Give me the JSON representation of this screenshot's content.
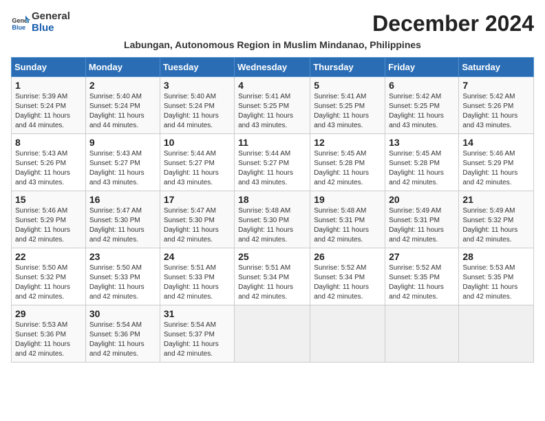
{
  "logo": {
    "general": "General",
    "blue": "Blue"
  },
  "header": {
    "month_title": "December 2024",
    "location": "Labungan, Autonomous Region in Muslim Mindanao, Philippines"
  },
  "weekdays": [
    "Sunday",
    "Monday",
    "Tuesday",
    "Wednesday",
    "Thursday",
    "Friday",
    "Saturday"
  ],
  "weeks": [
    [
      {
        "day": "1",
        "sunrise": "5:39 AM",
        "sunset": "5:24 PM",
        "daylight": "11 hours and 44 minutes."
      },
      {
        "day": "2",
        "sunrise": "5:40 AM",
        "sunset": "5:24 PM",
        "daylight": "11 hours and 44 minutes."
      },
      {
        "day": "3",
        "sunrise": "5:40 AM",
        "sunset": "5:24 PM",
        "daylight": "11 hours and 44 minutes."
      },
      {
        "day": "4",
        "sunrise": "5:41 AM",
        "sunset": "5:25 PM",
        "daylight": "11 hours and 43 minutes."
      },
      {
        "day": "5",
        "sunrise": "5:41 AM",
        "sunset": "5:25 PM",
        "daylight": "11 hours and 43 minutes."
      },
      {
        "day": "6",
        "sunrise": "5:42 AM",
        "sunset": "5:25 PM",
        "daylight": "11 hours and 43 minutes."
      },
      {
        "day": "7",
        "sunrise": "5:42 AM",
        "sunset": "5:26 PM",
        "daylight": "11 hours and 43 minutes."
      }
    ],
    [
      {
        "day": "8",
        "sunrise": "5:43 AM",
        "sunset": "5:26 PM",
        "daylight": "11 hours and 43 minutes."
      },
      {
        "day": "9",
        "sunrise": "5:43 AM",
        "sunset": "5:27 PM",
        "daylight": "11 hours and 43 minutes."
      },
      {
        "day": "10",
        "sunrise": "5:44 AM",
        "sunset": "5:27 PM",
        "daylight": "11 hours and 43 minutes."
      },
      {
        "day": "11",
        "sunrise": "5:44 AM",
        "sunset": "5:27 PM",
        "daylight": "11 hours and 43 minutes."
      },
      {
        "day": "12",
        "sunrise": "5:45 AM",
        "sunset": "5:28 PM",
        "daylight": "11 hours and 42 minutes."
      },
      {
        "day": "13",
        "sunrise": "5:45 AM",
        "sunset": "5:28 PM",
        "daylight": "11 hours and 42 minutes."
      },
      {
        "day": "14",
        "sunrise": "5:46 AM",
        "sunset": "5:29 PM",
        "daylight": "11 hours and 42 minutes."
      }
    ],
    [
      {
        "day": "15",
        "sunrise": "5:46 AM",
        "sunset": "5:29 PM",
        "daylight": "11 hours and 42 minutes."
      },
      {
        "day": "16",
        "sunrise": "5:47 AM",
        "sunset": "5:30 PM",
        "daylight": "11 hours and 42 minutes."
      },
      {
        "day": "17",
        "sunrise": "5:47 AM",
        "sunset": "5:30 PM",
        "daylight": "11 hours and 42 minutes."
      },
      {
        "day": "18",
        "sunrise": "5:48 AM",
        "sunset": "5:30 PM",
        "daylight": "11 hours and 42 minutes."
      },
      {
        "day": "19",
        "sunrise": "5:48 AM",
        "sunset": "5:31 PM",
        "daylight": "11 hours and 42 minutes."
      },
      {
        "day": "20",
        "sunrise": "5:49 AM",
        "sunset": "5:31 PM",
        "daylight": "11 hours and 42 minutes."
      },
      {
        "day": "21",
        "sunrise": "5:49 AM",
        "sunset": "5:32 PM",
        "daylight": "11 hours and 42 minutes."
      }
    ],
    [
      {
        "day": "22",
        "sunrise": "5:50 AM",
        "sunset": "5:32 PM",
        "daylight": "11 hours and 42 minutes."
      },
      {
        "day": "23",
        "sunrise": "5:50 AM",
        "sunset": "5:33 PM",
        "daylight": "11 hours and 42 minutes."
      },
      {
        "day": "24",
        "sunrise": "5:51 AM",
        "sunset": "5:33 PM",
        "daylight": "11 hours and 42 minutes."
      },
      {
        "day": "25",
        "sunrise": "5:51 AM",
        "sunset": "5:34 PM",
        "daylight": "11 hours and 42 minutes."
      },
      {
        "day": "26",
        "sunrise": "5:52 AM",
        "sunset": "5:34 PM",
        "daylight": "11 hours and 42 minutes."
      },
      {
        "day": "27",
        "sunrise": "5:52 AM",
        "sunset": "5:35 PM",
        "daylight": "11 hours and 42 minutes."
      },
      {
        "day": "28",
        "sunrise": "5:53 AM",
        "sunset": "5:35 PM",
        "daylight": "11 hours and 42 minutes."
      }
    ],
    [
      {
        "day": "29",
        "sunrise": "5:53 AM",
        "sunset": "5:36 PM",
        "daylight": "11 hours and 42 minutes."
      },
      {
        "day": "30",
        "sunrise": "5:54 AM",
        "sunset": "5:36 PM",
        "daylight": "11 hours and 42 minutes."
      },
      {
        "day": "31",
        "sunrise": "5:54 AM",
        "sunset": "5:37 PM",
        "daylight": "11 hours and 42 minutes."
      },
      null,
      null,
      null,
      null
    ]
  ],
  "labels": {
    "sunrise": "Sunrise:",
    "sunset": "Sunset:",
    "daylight": "Daylight:"
  }
}
